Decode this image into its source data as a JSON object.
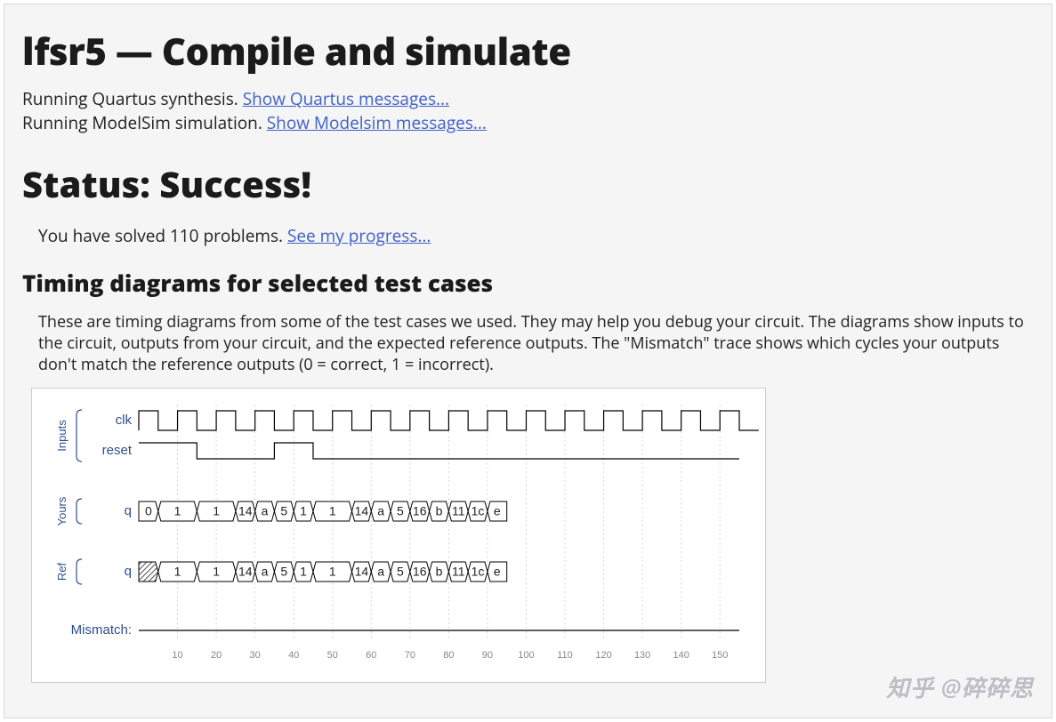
{
  "title": "lfsr5 — Compile and simulate",
  "synthesis_line_prefix": "Running Quartus synthesis. ",
  "synthesis_link": "Show Quartus messages...",
  "simulation_line_prefix": "Running ModelSim simulation. ",
  "simulation_link": "Show Modelsim messages...",
  "status_heading": "Status: Success!",
  "solved_prefix": "You have solved 110 problems. ",
  "solved_link": "See my progress...",
  "timing_heading": "Timing diagrams for selected test cases",
  "timing_desc": "These are timing diagrams from some of the test cases we used. They may help you debug your circuit. The diagrams show inputs to the circuit, outputs from your circuit, and the expected reference outputs. The \"Mismatch\" trace shows which cycles your outputs don't match the reference outputs (0 = correct, 1 = incorrect).",
  "watermark": "知乎 @碎碎思",
  "chart_data": {
    "type": "timing-diagram",
    "groups": [
      {
        "name": "Inputs",
        "signals": [
          "clk",
          "reset"
        ]
      },
      {
        "name": "Yours",
        "signals": [
          "q"
        ]
      },
      {
        "name": "Ref",
        "signals": [
          "q"
        ]
      }
    ],
    "mismatch_label": "Mismatch:",
    "time_axis": {
      "start": 0,
      "end": 155,
      "ticks": [
        10,
        20,
        30,
        40,
        50,
        60,
        70,
        80,
        90,
        100,
        110,
        120,
        130,
        140,
        150
      ]
    },
    "clk_period": 10,
    "reset": [
      {
        "t0": 0,
        "t1": 15,
        "level": 1
      },
      {
        "t0": 15,
        "t1": 35,
        "level": 0
      },
      {
        "t0": 35,
        "t1": 45,
        "level": 1
      },
      {
        "t0": 45,
        "t1": 155,
        "level": 0
      }
    ],
    "yours_q": [
      {
        "t0": 0,
        "t1": 5,
        "value": "0"
      },
      {
        "t0": 5,
        "t1": 15,
        "value": "1"
      },
      {
        "t0": 15,
        "t1": 25,
        "value": "1"
      },
      {
        "t0": 25,
        "t1": 30,
        "value": "14"
      },
      {
        "t0": 30,
        "t1": 35,
        "value": "a"
      },
      {
        "t0": 35,
        "t1": 40,
        "value": "5"
      },
      {
        "t0": 40,
        "t1": 45,
        "value": "1"
      },
      {
        "t0": 45,
        "t1": 55,
        "value": "1"
      },
      {
        "t0": 55,
        "t1": 60,
        "value": "14"
      },
      {
        "t0": 60,
        "t1": 65,
        "value": "a"
      },
      {
        "t0": 65,
        "t1": 70,
        "value": "5"
      },
      {
        "t0": 70,
        "t1": 75,
        "value": "16"
      },
      {
        "t0": 75,
        "t1": 80,
        "value": "b"
      },
      {
        "t0": 80,
        "t1": 85,
        "value": "11"
      },
      {
        "t0": 85,
        "t1": 90,
        "value": "1c"
      },
      {
        "t0": 90,
        "t1": 95,
        "value": "e"
      }
    ],
    "ref_q": [
      {
        "t0": 0,
        "t1": 5,
        "value": null,
        "hatched": true
      },
      {
        "t0": 5,
        "t1": 15,
        "value": "1"
      },
      {
        "t0": 15,
        "t1": 25,
        "value": "1"
      },
      {
        "t0": 25,
        "t1": 30,
        "value": "14"
      },
      {
        "t0": 30,
        "t1": 35,
        "value": "a"
      },
      {
        "t0": 35,
        "t1": 40,
        "value": "5"
      },
      {
        "t0": 40,
        "t1": 45,
        "value": "1"
      },
      {
        "t0": 45,
        "t1": 55,
        "value": "1"
      },
      {
        "t0": 55,
        "t1": 60,
        "value": "14"
      },
      {
        "t0": 60,
        "t1": 65,
        "value": "a"
      },
      {
        "t0": 65,
        "t1": 70,
        "value": "5"
      },
      {
        "t0": 70,
        "t1": 75,
        "value": "16"
      },
      {
        "t0": 75,
        "t1": 80,
        "value": "b"
      },
      {
        "t0": 80,
        "t1": 85,
        "value": "11"
      },
      {
        "t0": 85,
        "t1": 90,
        "value": "1c"
      },
      {
        "t0": 90,
        "t1": 95,
        "value": "e"
      }
    ],
    "mismatch": []
  }
}
